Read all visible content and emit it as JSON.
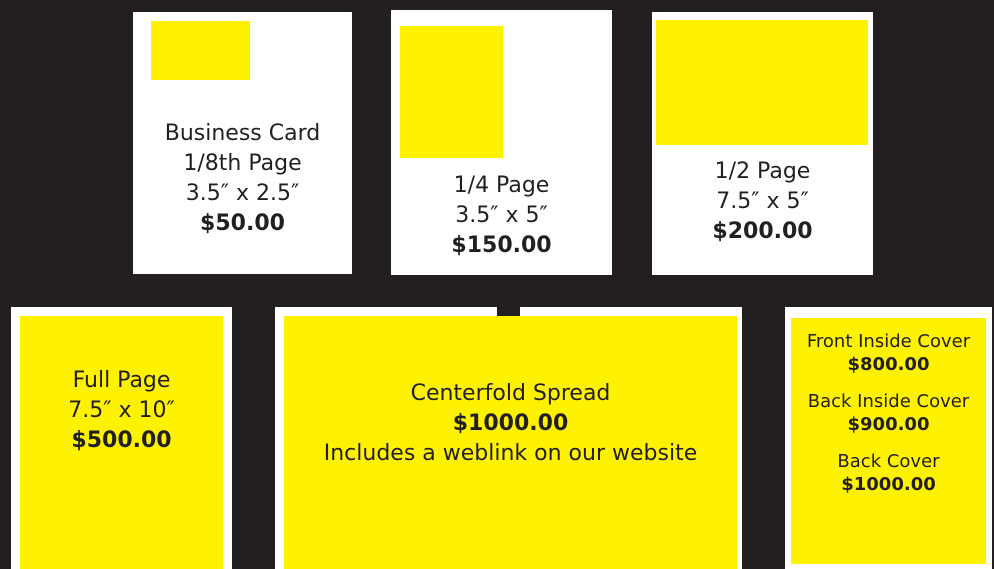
{
  "colors": {
    "background": "#231f20",
    "card": "#ffffff",
    "ad_fill": "#fff200",
    "text": "#231f20"
  },
  "ads": {
    "business_card": {
      "line1": "Business Card",
      "line2": "1/8th Page",
      "size": "3.5″ x 2.5″",
      "price": "$50.00"
    },
    "quarter_page": {
      "line1": "1/4 Page",
      "size": "3.5″ x 5″",
      "price": "$150.00"
    },
    "half_page": {
      "line1": "1/2 Page",
      "size": "7.5″ x 5″",
      "price": "$200.00"
    },
    "full_page": {
      "line1": "Full Page",
      "size": "7.5″ x 10″",
      "price": "$500.00"
    },
    "centerfold": {
      "line1": "Centerfold Spread",
      "price": "$1000.00",
      "note": "Includes a weblink on our website"
    },
    "covers": [
      {
        "label": "Front Inside Cover",
        "price": "$800.00"
      },
      {
        "label": "Back Inside Cover",
        "price": "$900.00"
      },
      {
        "label": "Back Cover",
        "price": "$1000.00"
      }
    ]
  }
}
